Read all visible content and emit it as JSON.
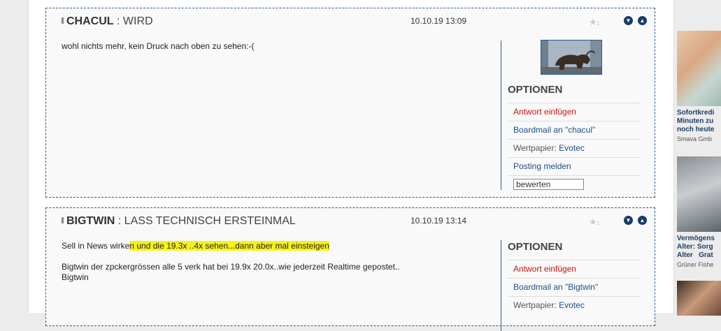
{
  "posts": [
    {
      "user": "CHACUL",
      "sep": " : ",
      "title": "WIRD",
      "date": "10.10.19 13:09",
      "star_count": "1",
      "body_lines": [
        "wohl nichts mehr, kein Druck nach oben zu sehen:-("
      ],
      "options": {
        "heading": "OPTIONEN",
        "reply": "Antwort einfügen",
        "boardmail": "Boardmail an \"chacul\"",
        "wertpapier_label": "Wertpapier: ",
        "wertpapier_value": "Evotec",
        "report": "Posting melden",
        "rate_value": "bewerten"
      }
    },
    {
      "user": "BIGTWIN",
      "sep": " : ",
      "title": "LASS TECHNISCH ERSTEINMAL",
      "date": "10.10.19 13:14",
      "star_count": "1",
      "body_line1_plain": "Sell in News wirke",
      "body_line1_highlight": "n und die 19.3x ..4x sehen...dann aber mal einsteigen",
      "body_line2": "Bigtwin der zpckergrössen alle 5 verk hat bei 19.9x 20.0x..wie jederzeit Realtime gepostet..",
      "body_line3": "Bigtwin",
      "options": {
        "heading": "OPTIONEN",
        "reply": "Antwort einfügen",
        "boardmail": "Boardmail an \"Bigtwin\"",
        "wertpapier_label": "Wertpapier: ",
        "wertpapier_value": "Evotec"
      }
    }
  ],
  "icons": {
    "star": "star-icon",
    "down": "arrow-down-circle-icon",
    "up": "arrow-up-circle-icon"
  },
  "ads": [
    {
      "title_lines": [
        "Sofortkredi",
        "Minuten zu",
        "noch heute"
      ],
      "source": "Smava Gmb"
    },
    {
      "title_lines": [
        "Vermögens",
        "Alter: Sorg",
        "Alter   Grat"
      ],
      "source": "Grüner Fishe"
    }
  ]
}
